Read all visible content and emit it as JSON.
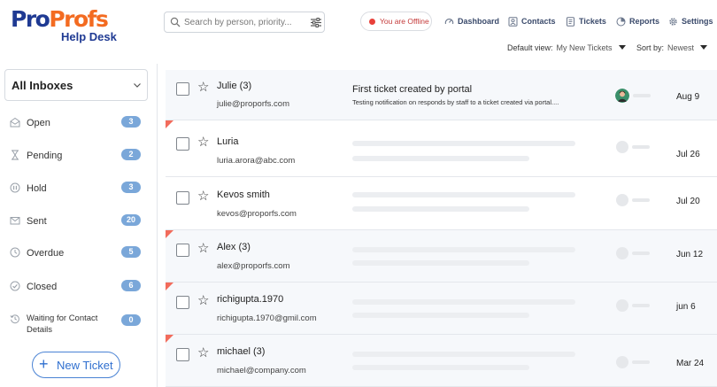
{
  "brand": {
    "logo_part1": "Pro",
    "logo_part2": "Profs",
    "logo_sub": "Help Desk"
  },
  "search": {
    "placeholder": "Search by person, priority..."
  },
  "status": {
    "label": "You are Offline",
    "color": "#e8403a"
  },
  "nav": {
    "dashboard": "Dashboard",
    "contacts": "Contacts",
    "tickets": "Tickets",
    "reports": "Reports",
    "settings": "Settings"
  },
  "view": {
    "default_label": "Default view:",
    "default_value": "My New Tickets",
    "sort_label": "Sort by:",
    "sort_value": "Newest"
  },
  "sidebar": {
    "inbox_select": "All Inboxes",
    "items": [
      {
        "label": "Open",
        "count": "3",
        "icon": "envelope-open-icon"
      },
      {
        "label": "Pending",
        "count": "2",
        "icon": "hourglass-icon"
      },
      {
        "label": "Hold",
        "count": "3",
        "icon": "pause-icon"
      },
      {
        "label": "Sent",
        "count": "20",
        "icon": "envelope-icon"
      },
      {
        "label": "Overdue",
        "count": "5",
        "icon": "clock-icon"
      },
      {
        "label": "Closed",
        "count": "6",
        "icon": "check-circle-icon"
      },
      {
        "label": "Waiting for Contact Details",
        "count": "0",
        "icon": "history-icon"
      }
    ],
    "new_ticket": "New Ticket"
  },
  "tickets": [
    {
      "name": "Julie (3)",
      "email": "julie@proporfs.com",
      "subject": "First ticket created by portal",
      "preview": "Testing notification on responds by staff to a ticket created via portal....",
      "date": "Aug 9",
      "flag": false
    },
    {
      "name": "Luria",
      "email": "luria.arora@abc.com",
      "subject": "",
      "preview": "",
      "date": "Jul 26",
      "flag": true
    },
    {
      "name": "Kevos smith",
      "email": "kevos@proporfs.com",
      "subject": "",
      "preview": "",
      "date": "Jul 20",
      "flag": false
    },
    {
      "name": "Alex  (3)",
      "email": "alex@proporfs.com",
      "subject": "",
      "preview": "",
      "date": "Jun 12",
      "flag": true
    },
    {
      "name": "richigupta.1970",
      "email": "richigupta.1970@gmil.com",
      "subject": "",
      "preview": "",
      "date": "jun 6",
      "flag": true
    },
    {
      "name": "michael (3)",
      "email": "michael@company.com",
      "subject": "",
      "preview": "",
      "date": "Mar 24",
      "flag": true
    }
  ],
  "colors": {
    "brand_blue": "#1f3a93",
    "brand_orange": "#f36b21",
    "badge": "#7aa7d9",
    "flag": "#f26b5b",
    "accent": "#2f6fcf"
  }
}
